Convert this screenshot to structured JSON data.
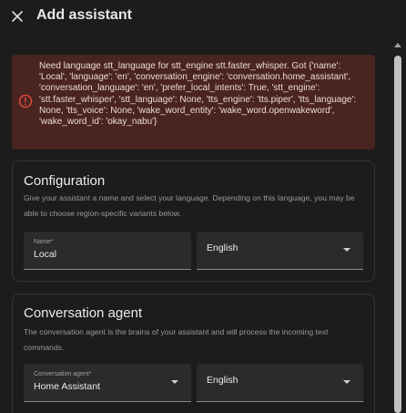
{
  "dialog": {
    "title": "Add assistant",
    "close_icon": "close-icon"
  },
  "error": {
    "icon": "alert-circle-icon",
    "color": "#e04a3c",
    "message": "Need language stt_language for stt_engine stt.faster_whisper. Got {'name': 'Local', 'language': 'en', 'conversation_engine': 'conversation.home_assistant', 'conversation_language': 'en', 'prefer_local_intents': True, 'stt_engine': 'stt.faster_whisper', 'stt_language': None, 'tts_engine': 'tts.piper', 'tts_language': None, 'tts_voice': None, 'wake_word_entity': 'wake_word.openwakeword', 'wake_word_id': 'okay_nabu'}"
  },
  "configuration": {
    "title": "Configuration",
    "description": "Give your assistant a name and select your language. Depending on this language, you may be able to choose region-specific variants below.",
    "name_label": "Name*",
    "name_value": "Local",
    "language_value": "English"
  },
  "conversation": {
    "title": "Conversation agent",
    "description": "The conversation agent is the brains of your assistant and will process the incoming text commands.",
    "agent_label": "Conversation agent*",
    "agent_value": "Home Assistant",
    "language_value": "English"
  }
}
